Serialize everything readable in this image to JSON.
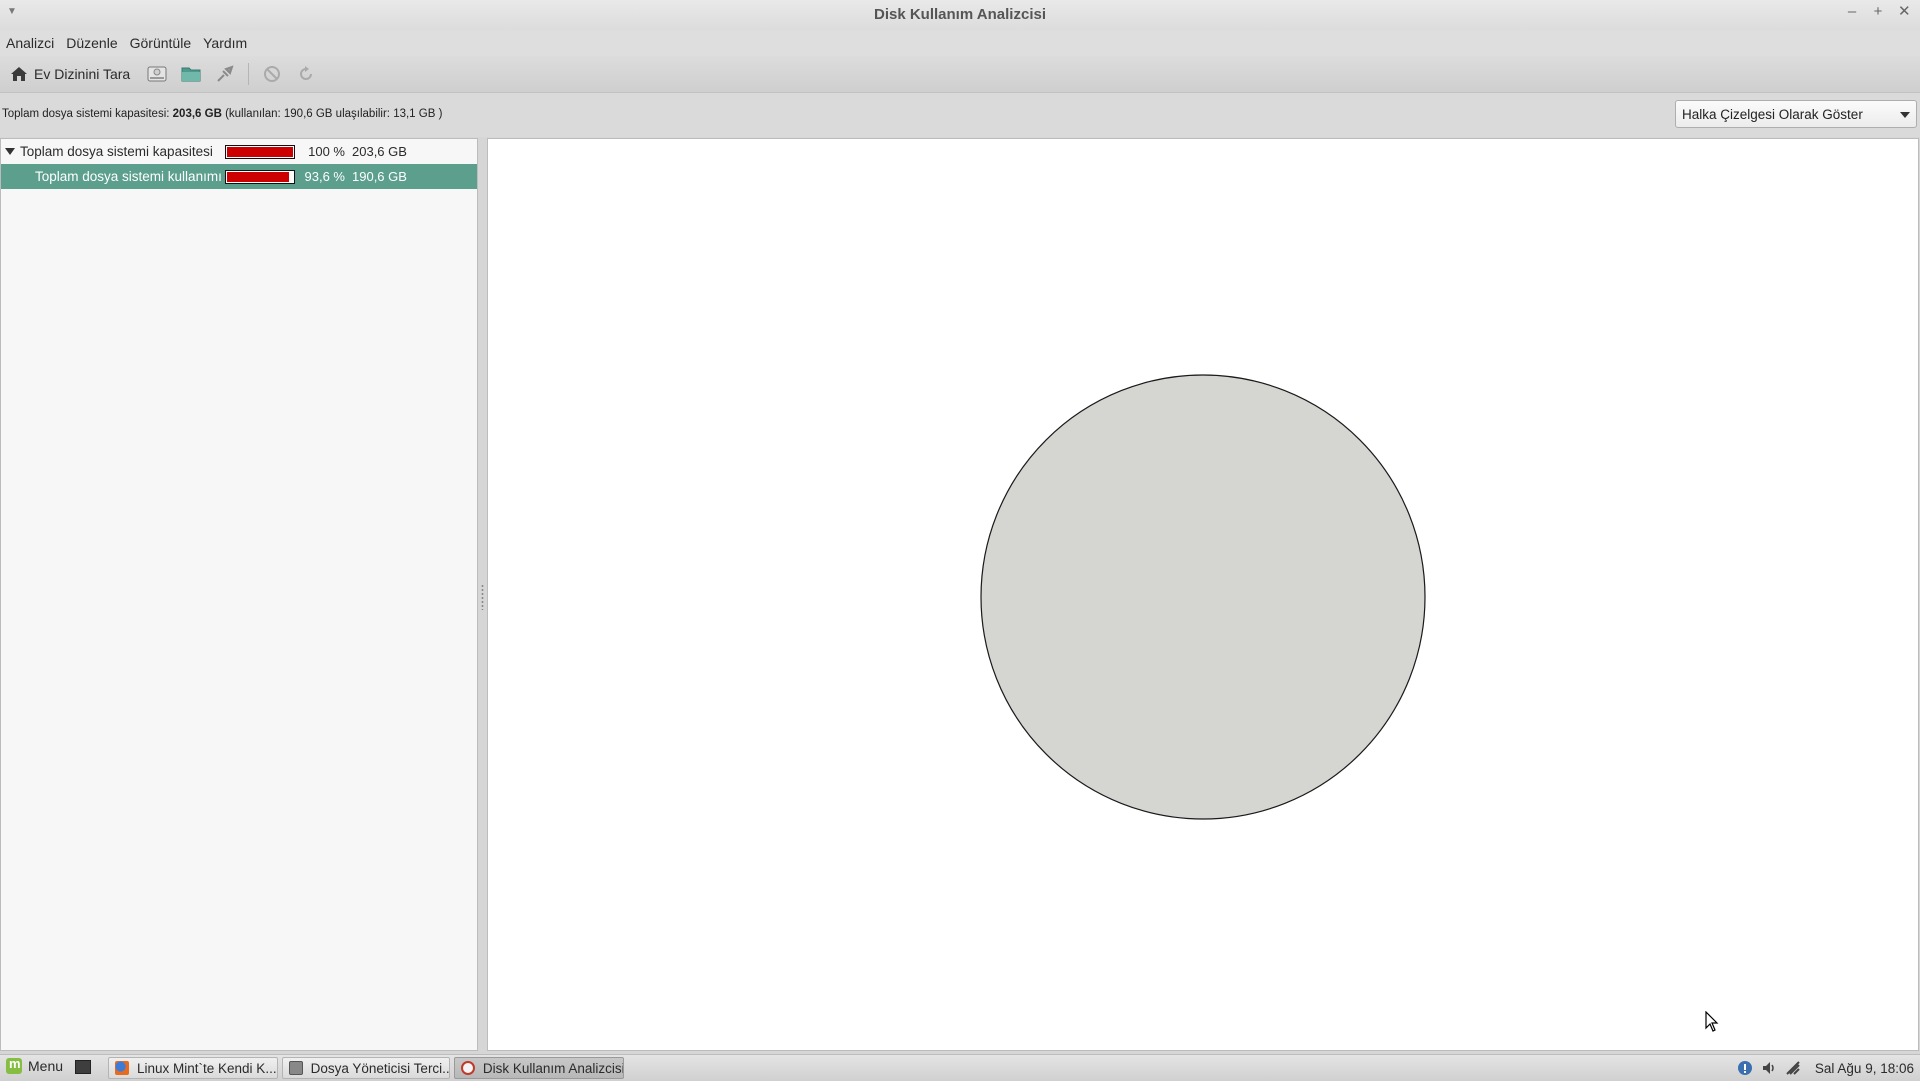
{
  "window": {
    "title": "Disk Kullanım Analizcisi"
  },
  "menubar": {
    "items": [
      "Analizci",
      "Düzenle",
      "Görüntüle",
      "Yardım"
    ]
  },
  "toolbar": {
    "scan_home_label": "Ev Dizinini Tara"
  },
  "infobar": {
    "capacity_prefix": "Toplam dosya sistemi kapasitesi: ",
    "capacity_value": "203,6 GB",
    "capacity_suffix": " (kullanılan: 190,6 GB ulaşılabilir: 13,1 GB )"
  },
  "view_select": {
    "selected": "Halka Çizelgesi Olarak Göster"
  },
  "tree": {
    "rows": [
      {
        "name": "Toplam dosya sistemi kapasitesi",
        "percent_text": "100 %",
        "size": "203,6 GB",
        "usage_fraction": 1.0,
        "expanded": true
      },
      {
        "name": "Toplam dosya sistemi kullanımı",
        "percent_text": "93,6 %",
        "size": "190,6 GB",
        "usage_fraction": 0.936,
        "selected": true
      }
    ]
  },
  "colors": {
    "usage_bar": "#cc0000",
    "selection": "#5b9f8c",
    "ring_fill": "#d5d6d2"
  },
  "taskbar": {
    "menu_label": "Menu",
    "tasks": [
      {
        "label": "Linux Mint`te Kendi K...",
        "icon": "firefox-icon"
      },
      {
        "label": "Dosya Yöneticisi Terci...",
        "icon": "preferences-window-icon"
      },
      {
        "label": "Disk Kullanım Analizcisi",
        "icon": "disk-analyzer-icon",
        "active": true
      }
    ],
    "clock": "Sal Ağu 9, 18:06"
  }
}
